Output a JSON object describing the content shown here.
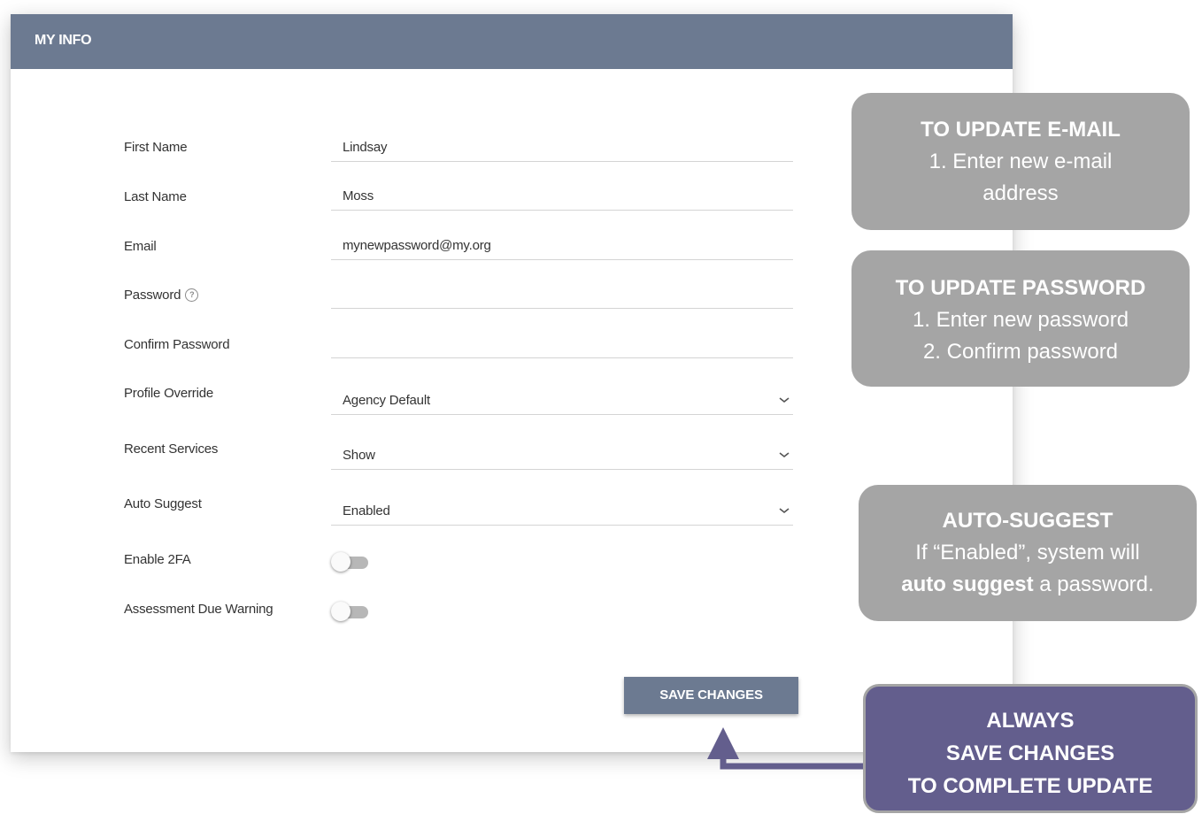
{
  "header": {
    "title": "MY INFO"
  },
  "form": {
    "first_name": {
      "label": "First Name",
      "value": "Lindsay"
    },
    "last_name": {
      "label": "Last Name",
      "value": "Moss"
    },
    "email": {
      "label": "Email",
      "value": "mynewpassword@my.org"
    },
    "password": {
      "label": "Password",
      "value": "",
      "help_icon": "?"
    },
    "confirm_password": {
      "label": "Confirm Password",
      "value": ""
    },
    "profile_override": {
      "label": "Profile Override",
      "value": "Agency Default"
    },
    "recent_services": {
      "label": "Recent Services",
      "value": "Show"
    },
    "auto_suggest": {
      "label": "Auto Suggest",
      "value": "Enabled"
    },
    "enable_2fa": {
      "label": "Enable 2FA",
      "on": false
    },
    "assessment_due_warning": {
      "label": "Assessment Due Warning",
      "on": false
    },
    "save_label": "SAVE CHANGES"
  },
  "callouts": {
    "email": {
      "title": "TO UPDATE E-MAIL",
      "line1": "1. Enter new e-mail",
      "line2": "address"
    },
    "password": {
      "title": "TO UPDATE PASSWORD",
      "line1": "1. Enter new password",
      "line2": "2. Confirm password"
    },
    "auto_suggest": {
      "title": "AUTO-SUGGEST",
      "line1": "If “Enabled”, system will",
      "line2_bold": "auto suggest",
      "line2_rest": " a password."
    },
    "save": {
      "line1": "ALWAYS",
      "line2": "SAVE CHANGES",
      "line3": "TO COMPLETE UPDATE"
    }
  },
  "colors": {
    "header": "#6c7a91",
    "callout_gray": "#a5a5a5",
    "callout_purple": "#635e8d",
    "arrow": "#635e8d"
  }
}
